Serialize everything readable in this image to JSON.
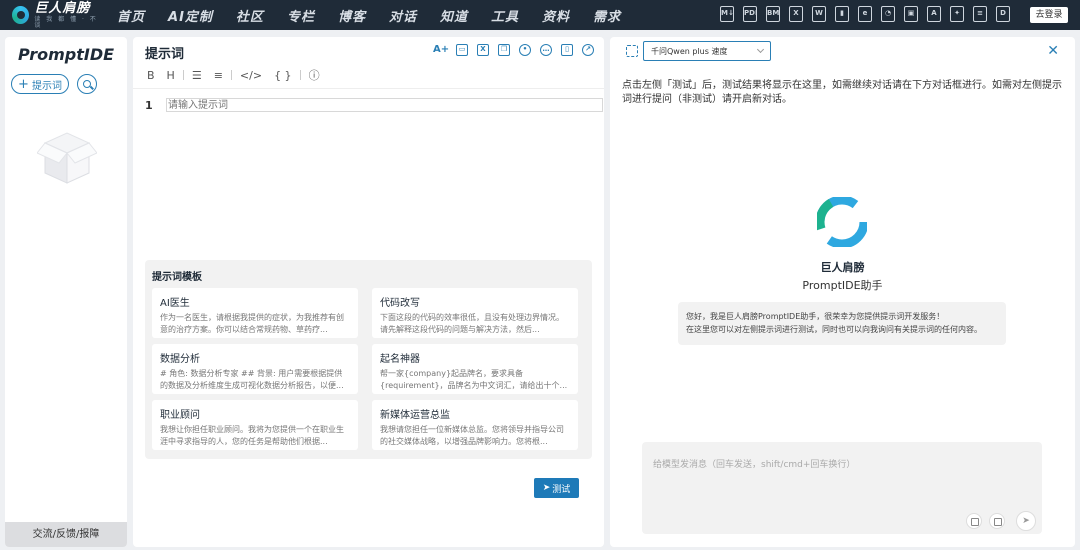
{
  "topbar": {
    "logo_name": "巨人肩膀",
    "logo_sub": "读 我 都 懂 · 不 谈",
    "nav": [
      "首页",
      "AI定制",
      "社区",
      "专栏",
      "博客",
      "对话",
      "知道",
      "工具",
      "资料",
      "需求"
    ],
    "icons": [
      {
        "name": "md-icon",
        "glyph": "M↓"
      },
      {
        "name": "pdf-icon",
        "glyph": "PDF"
      },
      {
        "name": "bmp-icon",
        "glyph": "BMP"
      },
      {
        "name": "excel-icon",
        "glyph": "X"
      },
      {
        "name": "word-icon",
        "glyph": "W"
      },
      {
        "name": "chart-icon",
        "glyph": "▮"
      },
      {
        "name": "browser-icon",
        "glyph": "e"
      },
      {
        "name": "pie-icon",
        "glyph": "◔"
      },
      {
        "name": "image-icon",
        "glyph": "▣"
      },
      {
        "name": "translate-icon",
        "glyph": "A"
      },
      {
        "name": "magic-icon",
        "glyph": "✦"
      },
      {
        "name": "doc-icon",
        "glyph": "≡"
      },
      {
        "name": "file-icon",
        "glyph": "D"
      }
    ],
    "login": "去登录"
  },
  "sidebar": {
    "brand": "PromptIDE",
    "add_label": "提示词",
    "feedback": "交流/反馈/报障"
  },
  "editor": {
    "title": "提示词",
    "format_tools": [
      "B",
      "H",
      "☰",
      "≡",
      "</>",
      "{ }",
      "ⓘ"
    ],
    "line_number": "1",
    "placeholder": "请输入提示词",
    "templates_title": "提示词模板",
    "templates": [
      {
        "name": "AI医生",
        "desc": "作为一名医生，请根据我提供的症状，为我推荐有创意的治疗方案。你可以结合常规药物、草药疗..."
      },
      {
        "name": "代码改写",
        "desc": "下面这段的代码的效率很低，且没有处理边界情况。请先解释这段代码的问题与解决方法，然后..."
      },
      {
        "name": "数据分析",
        "desc": "# 角色: 数据分析专家 ## 背景: 用户需要根据提供的数据及分析维度生成可视化数据分析报告，以便..."
      },
      {
        "name": "起名神器",
        "desc": "帮一家{company}起品牌名，要求具备{requirement}，品牌名为中文词汇，请给出十个..."
      },
      {
        "name": "职业顾问",
        "desc": "我想让你担任职业顾问。我将为您提供一个在职业生涯中寻求指导的人，您的任务是帮助他们根据..."
      },
      {
        "name": "新媒体运营总监",
        "desc": "我想请您担任一位新媒体总监。您将领导并指导公司的社交媒体战略，以增强品牌影响力。您将根..."
      }
    ],
    "test_label": "测试"
  },
  "chat": {
    "model": "千问Qwen plus 速度",
    "hint": "点击左侧「测试」后，测试结果将显示在这里，如需继续对话请在下方对话框进行。如需对左侧提示词进行提问（非测试）请开启新对话。",
    "bot_name": "巨人肩膀",
    "bot_sub": "PromptIDE助手",
    "bot_msg_1": "您好，我是巨人肩膀PromptIDE助手，很荣幸为您提供提示词开发服务！",
    "bot_msg_2": "在这里您可以对左侧提示词进行测试，同时也可以向我询问有关提示词的任何内容。",
    "input_placeholder": "给模型发消息（回车发送，shift/cmd+回车换行）"
  },
  "colors": {
    "nav_bg": "#1f2b38",
    "accent": "#2a7fb5",
    "test_btn": "#1e7ab8"
  }
}
